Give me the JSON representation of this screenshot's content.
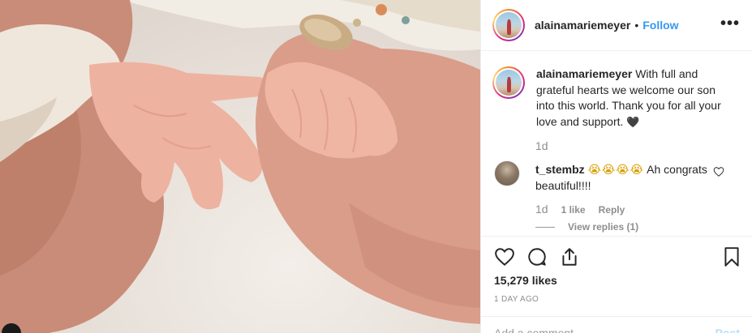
{
  "post": {
    "username": "alainamariemeyer",
    "follow_label": "Follow",
    "more_label": "•••"
  },
  "caption": {
    "username": "alainamariemeyer",
    "text": "With full and grateful hearts we welcome our son into this world. Thank you for all your love and support.",
    "emoji": "🖤",
    "time": "1d"
  },
  "comment": {
    "username": "t_stembz",
    "emoji": "😭😭😭😭",
    "text": "Ah congrats beautiful!!!!",
    "time": "1d",
    "likes": "1 like",
    "reply_label": "Reply",
    "view_replies": "View replies (1)"
  },
  "stats": {
    "likes": "15,279 likes",
    "posted": "1 DAY AGO"
  },
  "add_comment": {
    "placeholder": "Add a comment…",
    "post_label": "Post"
  },
  "colors": {
    "link_blue": "#3897f0",
    "muted": "#8e8e8e",
    "text": "#262626"
  }
}
